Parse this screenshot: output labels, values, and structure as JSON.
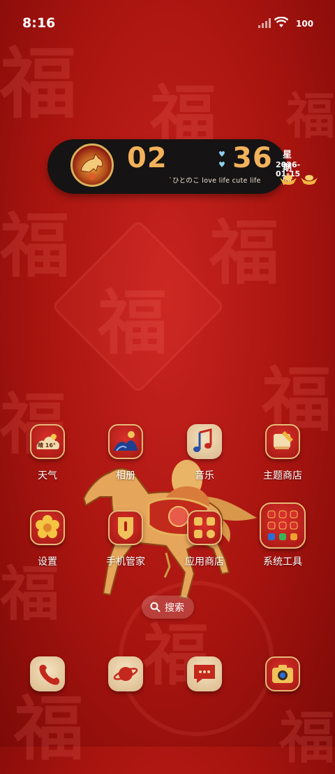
{
  "status_bar": {
    "time": "8:16",
    "battery_level": "100",
    "signal_icon": "signal-bars-icon",
    "wifi_icon": "wifi-icon"
  },
  "widget": {
    "hours": "02",
    "minutes": "36",
    "weekday": "星期四",
    "date": "2026-01-15",
    "tagline": "`ひとのこ love life cute life"
  },
  "apps": {
    "row1": [
      {
        "label": "天气",
        "icon": "weather-icon",
        "badge": "晴 16°"
      },
      {
        "label": "相册",
        "icon": "gallery-icon"
      },
      {
        "label": "音乐",
        "icon": "music-note-icon"
      },
      {
        "label": "主题商店",
        "icon": "theme-brush-icon"
      }
    ],
    "row2": [
      {
        "label": "设置",
        "icon": "settings-flower-icon"
      },
      {
        "label": "手机管家",
        "icon": "phone-manager-shield-icon"
      },
      {
        "label": "应用商店",
        "icon": "app-store-grid-icon"
      },
      {
        "label": "系统工具",
        "icon": "system-tools-folder-icon"
      }
    ]
  },
  "dock": [
    {
      "icon": "phone-icon"
    },
    {
      "icon": "browser-planet-icon"
    },
    {
      "icon": "messages-icon"
    },
    {
      "icon": "camera-icon"
    }
  ],
  "search": {
    "label": "搜索",
    "icon": "search-icon"
  },
  "wallpaper": {
    "background_glyph": "福",
    "colors": {
      "primary": "#b81a15",
      "accent": "#f2b15b",
      "widget_bg": "#151313"
    }
  }
}
